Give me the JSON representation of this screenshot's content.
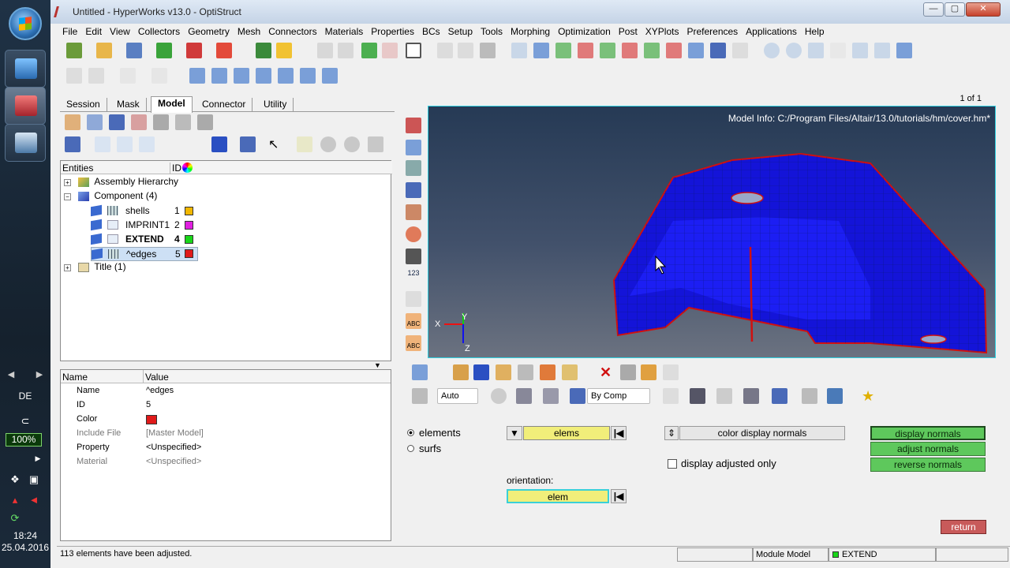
{
  "window": {
    "title": "Untitled - HyperWorks v13.0 - OptiStruct",
    "controls": {
      "minimize": "—",
      "maximize": "▢",
      "close": "✕"
    }
  },
  "menubar": [
    "File",
    "Edit",
    "View",
    "Collectors",
    "Geometry",
    "Mesh",
    "Connectors",
    "Materials",
    "Properties",
    "BCs",
    "Setup",
    "Tools",
    "Morphing",
    "Optimization",
    "Post",
    "XYPlots",
    "Preferences",
    "Applications",
    "Help"
  ],
  "browser": {
    "tabs": [
      "Session",
      "Mask",
      "Model",
      "Connector",
      "Utility"
    ],
    "active_tab": "Model",
    "columns": {
      "entities": "Entities",
      "id": "ID"
    },
    "tree": [
      {
        "label": "Assembly Hierarchy",
        "expand": "+"
      },
      {
        "label": "Component (4)",
        "expand": "−"
      },
      {
        "label": "shells",
        "id": "1",
        "color": "#f2b700"
      },
      {
        "label": "IMPRINT1",
        "id": "2",
        "color": "#e020e0"
      },
      {
        "label": "EXTEND",
        "id": "4",
        "color": "#19d619"
      },
      {
        "label": "^edges",
        "id": "5",
        "color": "#e01a1a"
      },
      {
        "label": "Title (1)",
        "expand": "+"
      }
    ],
    "splitter": "▼"
  },
  "properties": {
    "columns": {
      "name": "Name",
      "value": "Value"
    },
    "rows": [
      {
        "name": "Name",
        "value": "^edges"
      },
      {
        "name": "ID",
        "value": "5"
      },
      {
        "name": "Color",
        "value": ""
      },
      {
        "name": "Include File",
        "value": "[Master Model]"
      },
      {
        "name": "Property",
        "value": "<Unspecified>"
      },
      {
        "name": "Material",
        "value": "<Unspecified>"
      }
    ],
    "color_value": "#e01a1a"
  },
  "graphics": {
    "model_info": "Model Info: C:/Program Files/Altair/13.0/tutorials/hm/cover.hm*",
    "page": "1 of 1",
    "triad": {
      "x": "X",
      "y": "Y",
      "z": "Z"
    }
  },
  "vtool_labels": {
    "num": "123",
    "abc1": "ABC",
    "abc2": "ABC"
  },
  "ptoolbar": {
    "display_mode": "Auto",
    "color_by": "By Comp"
  },
  "panel": {
    "radio_elements": "elements",
    "radio_surfs": "surfs",
    "elems_btn": "elems",
    "color_display_normals": "color display normals",
    "display_adjusted_only": "display adjusted only",
    "orientation_label": "orientation:",
    "elem_btn": "elem",
    "display_normals": "display normals",
    "adjust_normals": "adjust normals",
    "reverse_normals": "reverse normals",
    "return_btn": "return"
  },
  "status": {
    "message": "113 elements have been adjusted.",
    "module": "Module Model",
    "component": "EXTEND"
  },
  "taskbar": {
    "lang": "DE",
    "battery": "100%",
    "time": "18:24",
    "date": "25.04.2016"
  }
}
